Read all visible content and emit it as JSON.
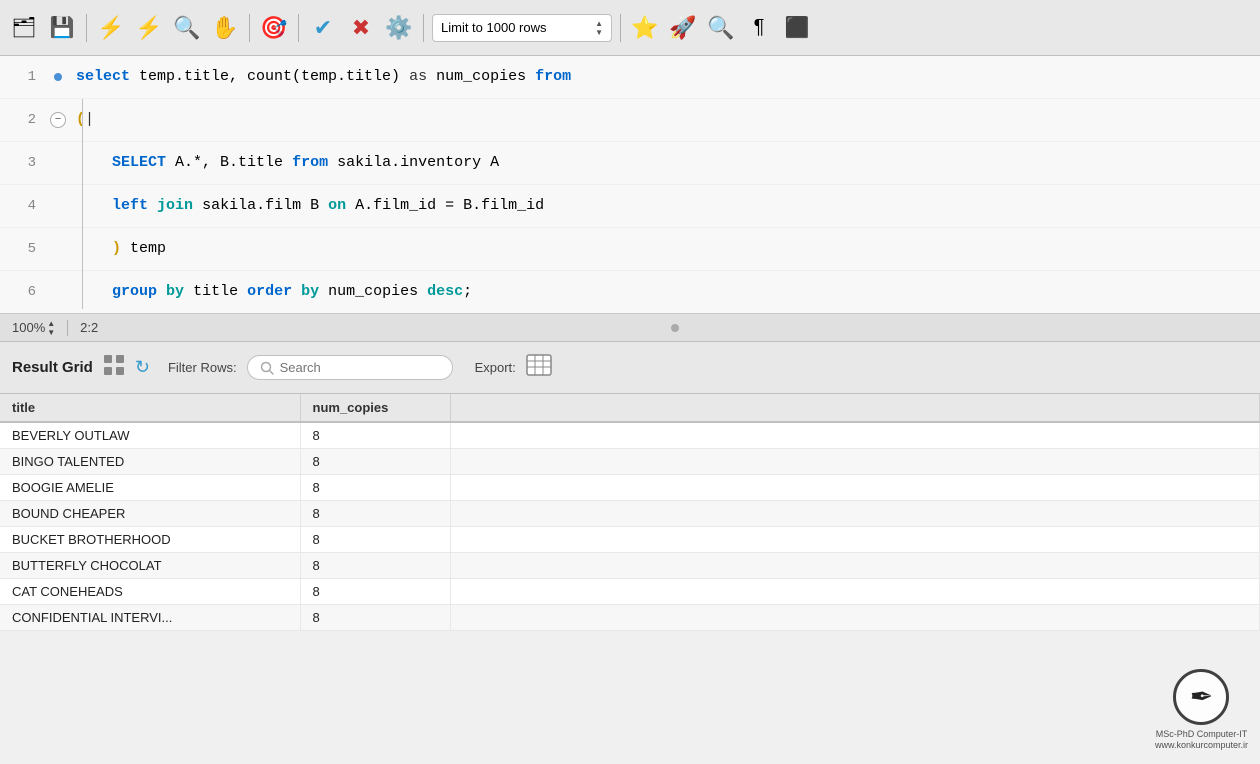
{
  "toolbar": {
    "limit_label": "Limit to 1000 rows",
    "icons": [
      {
        "name": "new-file-icon",
        "glyph": "🗂"
      },
      {
        "name": "save-icon",
        "glyph": "💾"
      },
      {
        "name": "execute-icon",
        "glyph": "⚡"
      },
      {
        "name": "execute-alt-icon",
        "glyph": "⚡"
      },
      {
        "name": "explain-icon",
        "glyph": "🔍"
      },
      {
        "name": "stop-icon",
        "glyph": "🛑"
      },
      {
        "name": "plugin-icon",
        "glyph": "🎯"
      },
      {
        "name": "check-icon",
        "glyph": "✅"
      },
      {
        "name": "cancel-icon",
        "glyph": "❌"
      },
      {
        "name": "format-icon",
        "glyph": "⚙️"
      },
      {
        "name": "bookmark-icon",
        "glyph": "⭐"
      },
      {
        "name": "snippet-icon",
        "glyph": "🚀"
      },
      {
        "name": "zoom-icon",
        "glyph": "🔍"
      },
      {
        "name": "wordwrap-icon",
        "glyph": "¶"
      },
      {
        "name": "history-icon",
        "glyph": "⬛"
      }
    ]
  },
  "editor": {
    "lines": [
      {
        "num": "1",
        "indicator": "dot",
        "content_html": "<span class='kw'>select</span> temp.title, count(temp.title) <span class='as-kw'>as</span> num_copies <span class='kw'>from</span>"
      },
      {
        "num": "2",
        "indicator": "collapse",
        "content_html": "<span style='color:#cc9900;font-weight:bold'>(</span>"
      },
      {
        "num": "3",
        "indicator": "none",
        "content_html": "    <span class='kw'>SELECT</span> A.*, B.title <span class='kw'>from</span> sakila.inventory A"
      },
      {
        "num": "4",
        "indicator": "none",
        "content_html": "    <span class='kw'>left</span> <span class='kw2'>join</span> sakila.film B <span class='kw2'>on</span> A.film_id = B.film_id"
      },
      {
        "num": "5",
        "indicator": "none",
        "content_html": "    <span style='color:#cc9900;font-weight:bold'>)</span> temp"
      },
      {
        "num": "6",
        "indicator": "none",
        "content_html": "    <span class='kw'>group</span> <span class='kw2'>by</span> title <span class='kw'>order</span> <span class='kw2'>by</span> num_copies <span class='kw2'>desc</span>;"
      }
    ]
  },
  "status_bar": {
    "zoom": "100%",
    "position": "2:2"
  },
  "result_grid": {
    "label": "Result Grid",
    "filter_label": "Filter Rows:",
    "search_placeholder": "Search",
    "export_label": "Export:",
    "columns": [
      "title",
      "num_copies"
    ],
    "rows": [
      {
        "title": "BEVERLY OUTLAW",
        "num_copies": "8"
      },
      {
        "title": "BINGO TALENTED",
        "num_copies": "8"
      },
      {
        "title": "BOOGIE AMELIE",
        "num_copies": "8"
      },
      {
        "title": "BOUND CHEAPER",
        "num_copies": "8"
      },
      {
        "title": "BUCKET BROTHERHOOD",
        "num_copies": "8"
      },
      {
        "title": "BUTTERFLY CHOCOLAT",
        "num_copies": "8"
      },
      {
        "title": "CAT CONEHEADS",
        "num_copies": "8"
      },
      {
        "title": "CONFIDENTIAL INTERVI...",
        "num_copies": "8"
      }
    ]
  },
  "watermark": {
    "line1": "MSc-PhD Computer-IT",
    "line2": "www.konkurcomputer.ir"
  }
}
